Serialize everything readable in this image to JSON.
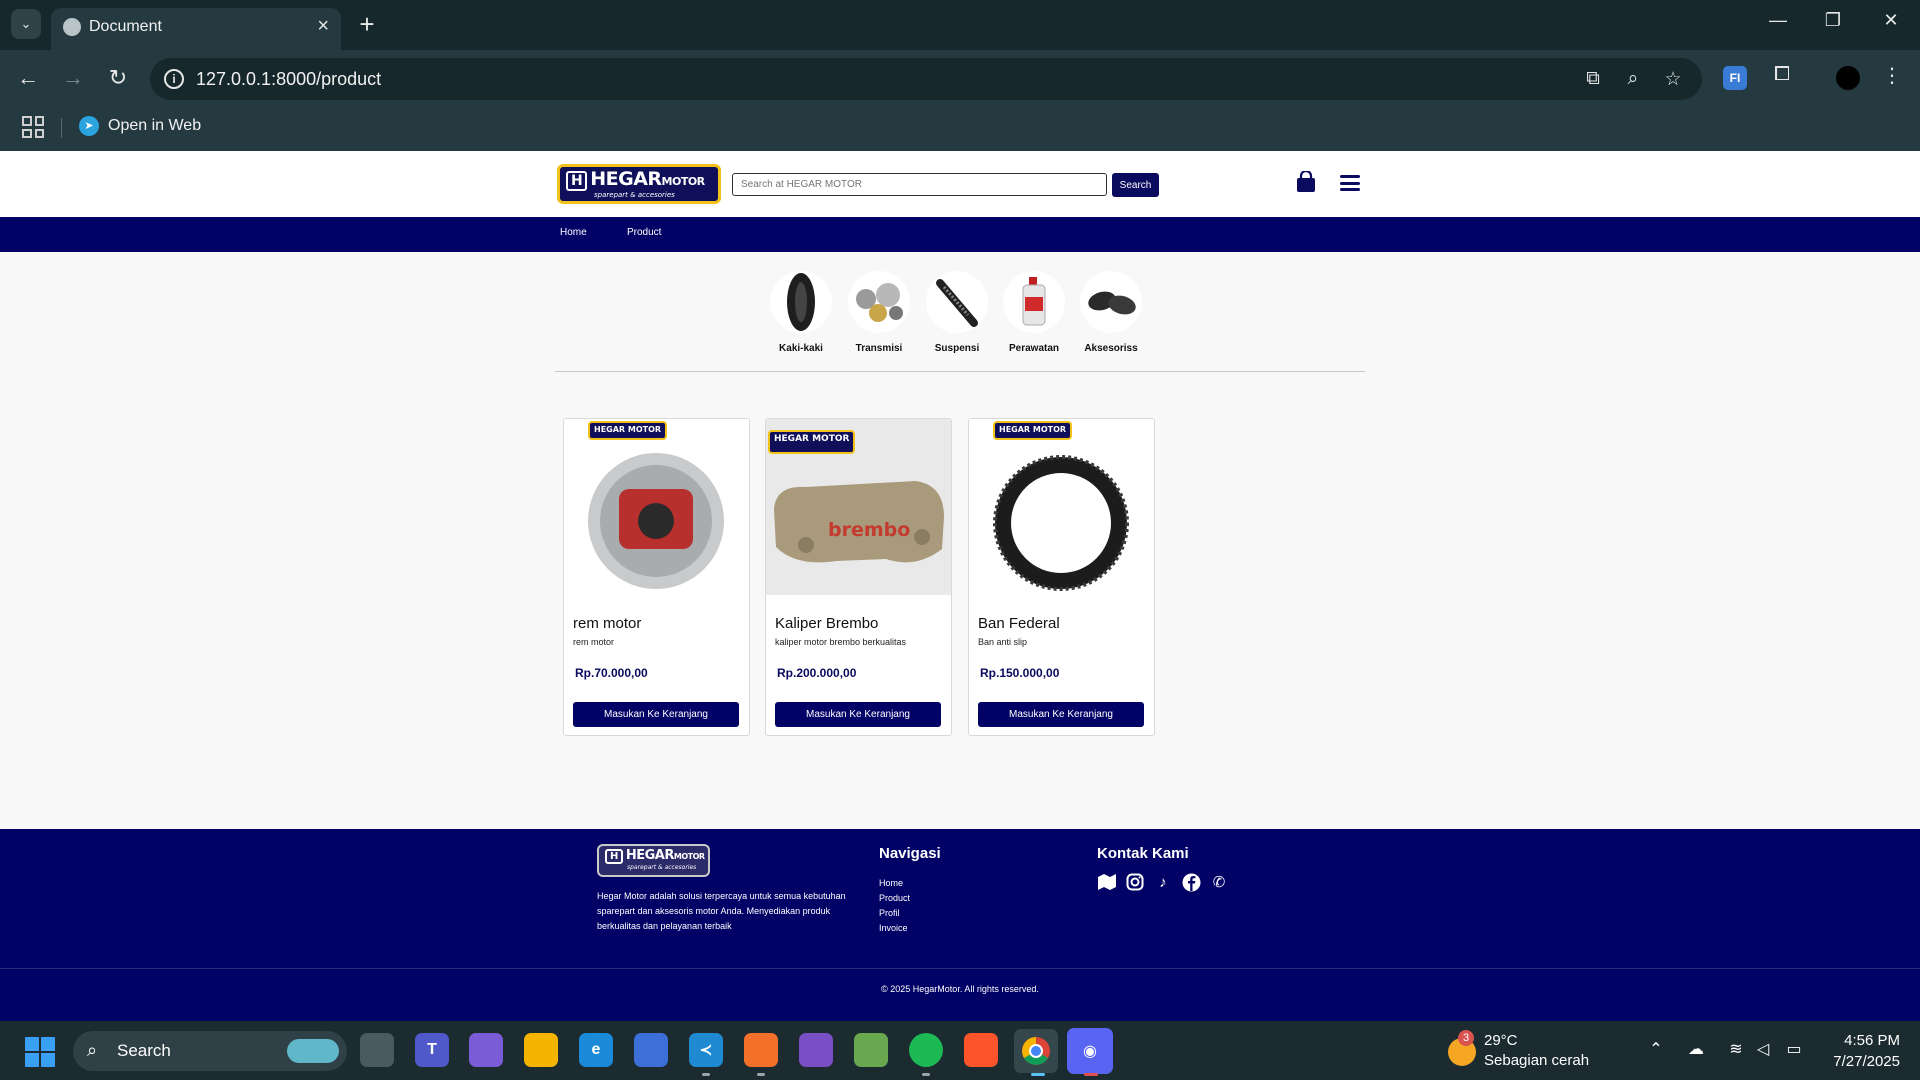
{
  "browser": {
    "tab_title": "Document",
    "url": "127.0.0.1:8000/product",
    "bookmark_label": "Open in Web"
  },
  "header": {
    "logo_text": "HEGAR",
    "logo_text_small": "MOTOR",
    "logo_tagline": "sparepart & accesories",
    "search_placeholder": "Search at HEGAR MOTOR",
    "search_button": "Search"
  },
  "nav": {
    "home": "Home",
    "product": "Product"
  },
  "categories": [
    {
      "label": "Kaki-kaki",
      "icon": "tire-icon"
    },
    {
      "label": "Transmisi",
      "icon": "transmission-parts-icon"
    },
    {
      "label": "Suspensi",
      "icon": "shock-absorber-icon"
    },
    {
      "label": "Perawatan",
      "icon": "oil-bottle-icon"
    },
    {
      "label": "Aksesoriss",
      "icon": "mirror-icon"
    }
  ],
  "products": [
    {
      "name": "rem motor",
      "description": "rem motor",
      "price": "Rp.70.000,00",
      "button": "Masukan Ke Keranjang",
      "badge": "HEGAR MOTOR"
    },
    {
      "name": "Kaliper Brembo",
      "description": "kaliper motor brembo berkualitas",
      "price": "Rp.200.000,00",
      "button": "Masukan Ke Keranjang",
      "badge": "HEGAR MOTOR",
      "image_text": "brembo"
    },
    {
      "name": "Ban Federal",
      "description": "Ban anti slip",
      "price": "Rp.150.000,00",
      "button": "Masukan Ke Keranjang",
      "badge": "HEGAR MOTOR"
    }
  ],
  "footer": {
    "about": "Hegar Motor adalah solusi terpercaya untuk semua kebutuhan sparepart dan aksesoris motor Anda. Menyediakan produk berkualitas dan pelayanan terbaik",
    "nav_title": "Navigasi",
    "links": [
      "Home",
      "Product",
      "Profil",
      "Invoice"
    ],
    "contact_title": "Kontak Kami",
    "social_icons": [
      "map-icon",
      "instagram-icon",
      "tiktok-icon",
      "facebook-icon",
      "phone-icon"
    ],
    "copyright": "© 2025 HegarMotor. All rights reserved."
  },
  "taskbar": {
    "search_label": "Search",
    "weather_count": "3",
    "temperature": "29°C",
    "condition": "Sebagian cerah",
    "time": "4:56 PM",
    "date": "7/27/2025"
  },
  "colors": {
    "brand_navy": "#020266",
    "logo_border": "#f3c21a",
    "browser_bg": "#243a40"
  }
}
